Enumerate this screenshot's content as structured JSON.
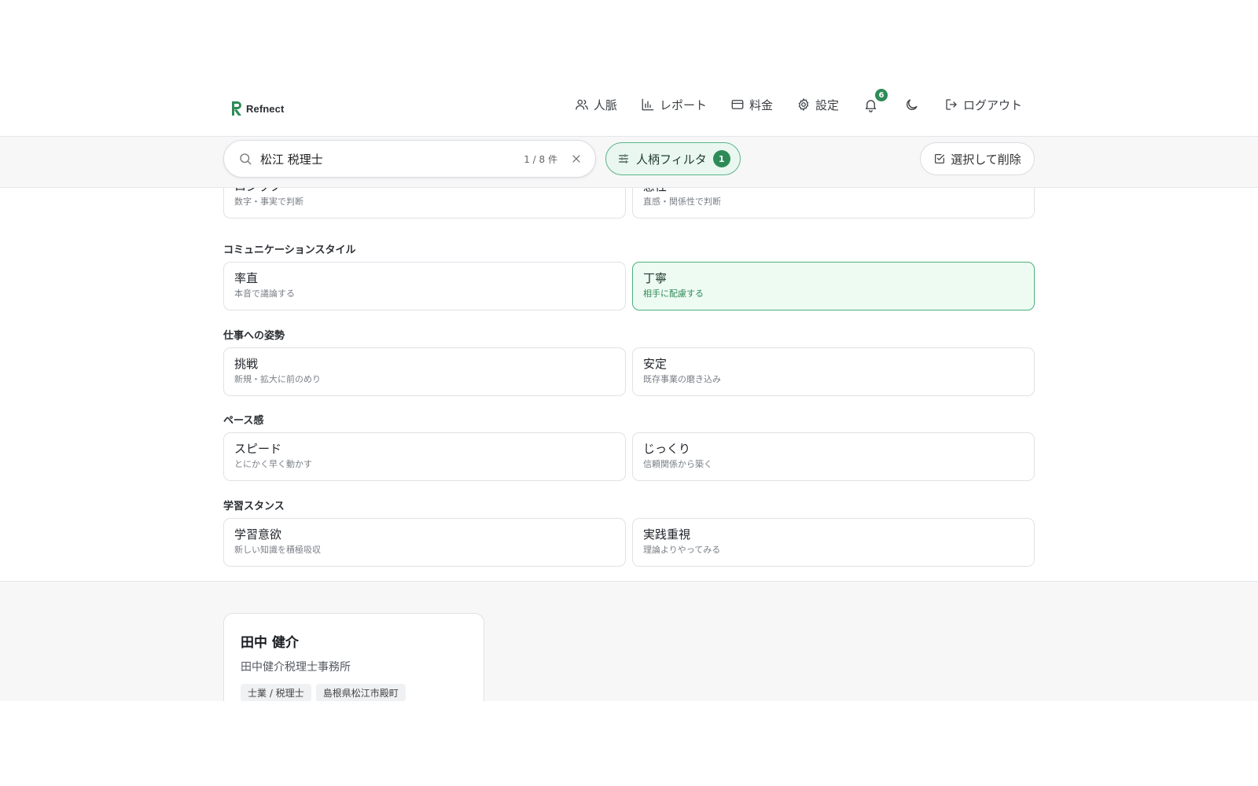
{
  "header": {
    "logo_letter": "R",
    "logo_text": "Refnect",
    "nav": [
      {
        "label": "人脈",
        "icon": "users-icon"
      },
      {
        "label": "レポート",
        "icon": "bar-chart-icon"
      },
      {
        "label": "料金",
        "icon": "credit-card-icon"
      },
      {
        "label": "設定",
        "icon": "gear-icon"
      }
    ],
    "notifications": {
      "count": "6",
      "icon": "bell-icon"
    },
    "theme_icon": "moon-icon",
    "logout_label": "ログアウト"
  },
  "toolbar": {
    "search": {
      "value": "松江 税理士",
      "placeholder": "",
      "result_count": "1 / 8 件"
    },
    "filter": {
      "label": "人柄フィルタ",
      "count": "1"
    },
    "delete_label": "選択して削除"
  },
  "filters": {
    "thinking": {
      "options": [
        {
          "title": "ロジック",
          "desc": "数字・事実で判断"
        },
        {
          "title": "感性",
          "desc": "直感・関係性で判断"
        }
      ]
    },
    "communication": {
      "title": "コミュニケーションスタイル",
      "options": [
        {
          "title": "率直",
          "desc": "本音で議論する"
        },
        {
          "title": "丁寧",
          "desc": "相手に配慮する"
        }
      ]
    },
    "work_attitude": {
      "title": "仕事への姿勢",
      "options": [
        {
          "title": "挑戦",
          "desc": "新規・拡大に前のめり"
        },
        {
          "title": "安定",
          "desc": "既存事業の磨き込み"
        }
      ]
    },
    "pace": {
      "title": "ペース感",
      "options": [
        {
          "title": "スピード",
          "desc": "とにかく早く動かす"
        },
        {
          "title": "じっくり",
          "desc": "信頼関係から築く"
        }
      ]
    },
    "learning": {
      "title": "学習スタンス",
      "options": [
        {
          "title": "学習意欲",
          "desc": "新しい知識を積極吸収"
        },
        {
          "title": "実践重視",
          "desc": "理論よりやってみる"
        }
      ]
    }
  },
  "results": [
    {
      "name": "田中 健介",
      "org": "田中健介税理士事務所",
      "tags": [
        "士業 / 税理士",
        "島根県松江市殿町"
      ]
    }
  ],
  "colors": {
    "accent": "#2e8b57",
    "selected_bg": "#eefbf3",
    "selected_border": "#4caf7d"
  }
}
